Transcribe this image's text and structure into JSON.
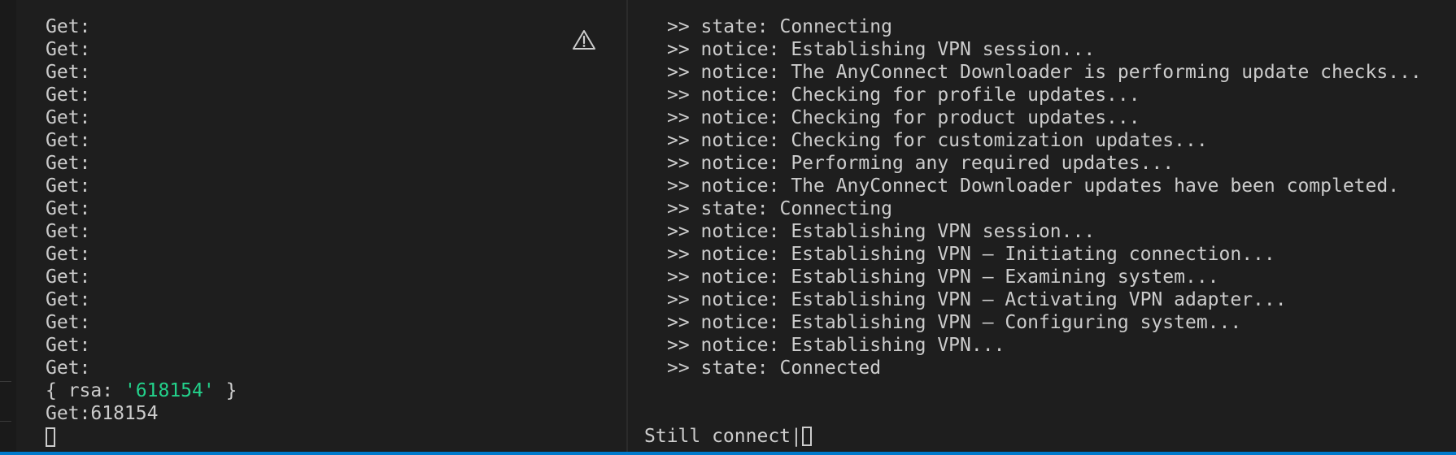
{
  "left_terminal": {
    "lines": [
      "Get:",
      "Get:",
      "Get:",
      "Get:",
      "Get:",
      "Get:",
      "Get:",
      "Get:",
      "Get:",
      "Get:",
      "Get:",
      "Get:",
      "Get:",
      "Get:",
      "Get:",
      "Get:"
    ],
    "rsa_line": {
      "prefix": "{ rsa: ",
      "value": "'618154'",
      "suffix": " }"
    },
    "result_line": "Get:618154",
    "warning_icon": "warning-triangle-icon"
  },
  "right_terminal": {
    "lines": [
      ">> state: Connecting",
      ">> notice: Establishing VPN session...",
      ">> notice: The AnyConnect Downloader is performing update checks...",
      ">> notice: Checking for profile updates...",
      ">> notice: Checking for product updates...",
      ">> notice: Checking for customization updates...",
      ">> notice: Performing any required updates...",
      ">> notice: The AnyConnect Downloader updates have been completed.",
      ">> state: Connecting",
      ">> notice: Establishing VPN session...",
      ">> notice: Establishing VPN – Initiating connection...",
      ">> notice: Establishing VPN – Examining system...",
      ">> notice: Establishing VPN – Activating VPN adapter...",
      ">> notice: Establishing VPN – Configuring system...",
      ">> notice: Establishing VPN...",
      ">> state: Connected"
    ],
    "prompt_text": "Still connect|"
  },
  "colors": {
    "background": "#1e1e1e",
    "text": "#cccccc",
    "string": "#23d18b",
    "status_bar": "#007acc"
  }
}
